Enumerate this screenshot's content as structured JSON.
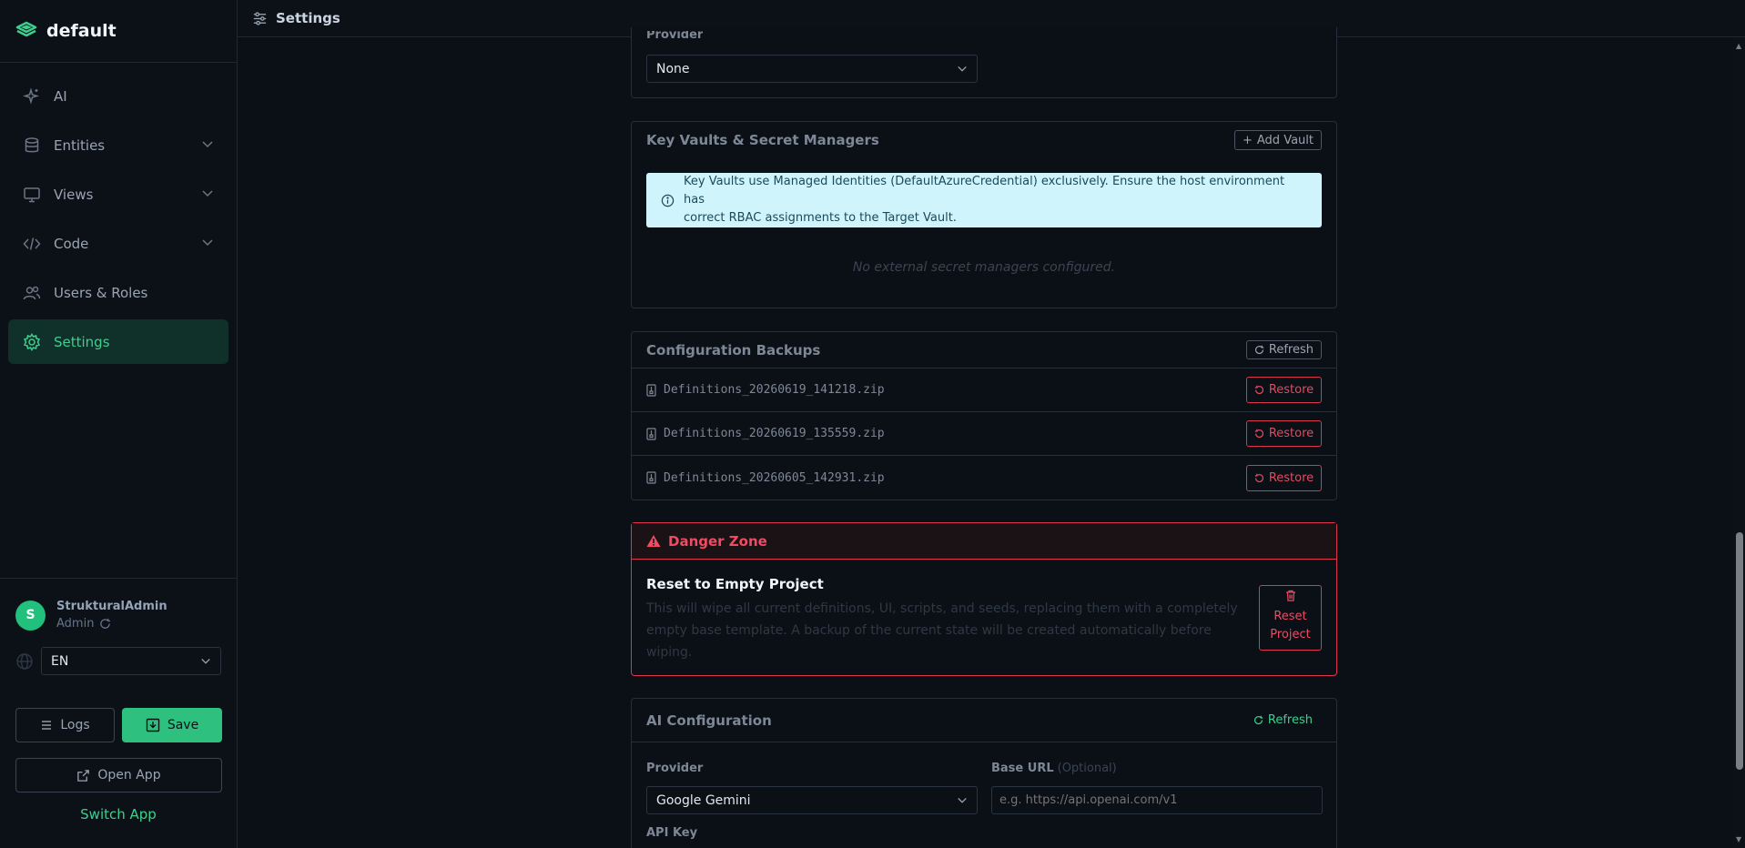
{
  "app": {
    "name": "default",
    "page_title": "Settings"
  },
  "sidebar": {
    "items": [
      {
        "label": "AI",
        "icon": "sparkles-icon",
        "expandable": false,
        "active": false
      },
      {
        "label": "Entities",
        "icon": "database-icon",
        "expandable": true,
        "active": false
      },
      {
        "label": "Views",
        "icon": "monitor-icon",
        "expandable": true,
        "active": false
      },
      {
        "label": "Code",
        "icon": "code-icon",
        "expandable": true,
        "active": false
      },
      {
        "label": "Users & Roles",
        "icon": "users-icon",
        "expandable": false,
        "active": false
      },
      {
        "label": "Settings",
        "icon": "gear-icon",
        "expandable": false,
        "active": true
      }
    ],
    "user": {
      "initial": "S",
      "name": "StrukturalAdmin",
      "role": "Admin"
    },
    "language": "EN",
    "logs_label": "Logs",
    "save_label": "Save",
    "open_app_label": "Open App",
    "switch_app_label": "Switch App"
  },
  "top_partial": {
    "label": "Provider",
    "value": "None"
  },
  "key_vaults": {
    "title": "Key Vaults & Secret Managers",
    "add_label": "Add Vault",
    "info_line1": "Key Vaults use Managed Identities (DefaultAzureCredential) exclusively. Ensure the host environment has",
    "info_line2": "correct RBAC assignments to the Target Vault.",
    "empty": "No external secret managers configured."
  },
  "backups": {
    "title": "Configuration Backups",
    "refresh_label": "Refresh",
    "restore_label": "Restore",
    "files": [
      "Definitions_20260619_141218.zip",
      "Definitions_20260619_135559.zip",
      "Definitions_20260605_142931.zip"
    ]
  },
  "danger": {
    "title": "Danger Zone",
    "reset_title": "Reset to Empty Project",
    "reset_desc": "This will wipe all current definitions, UI, scripts, and seeds, replacing them with a completely empty base template. A backup of the current state will be created automatically before wiping.",
    "reset_btn_line1": "Reset",
    "reset_btn_line2": "Project"
  },
  "ai_config": {
    "title": "AI Configuration",
    "refresh_label": "Refresh",
    "provider_label": "Provider",
    "provider_value": "Google Gemini",
    "base_url_label": "Base URL",
    "base_url_optional": "(Optional)",
    "base_url_placeholder": "e.g. https://api.openai.com/v1",
    "api_key_label": "API Key"
  },
  "colors": {
    "accent": "#2ec07e",
    "danger": "#e0354e",
    "info_bg": "#cff4fc"
  }
}
